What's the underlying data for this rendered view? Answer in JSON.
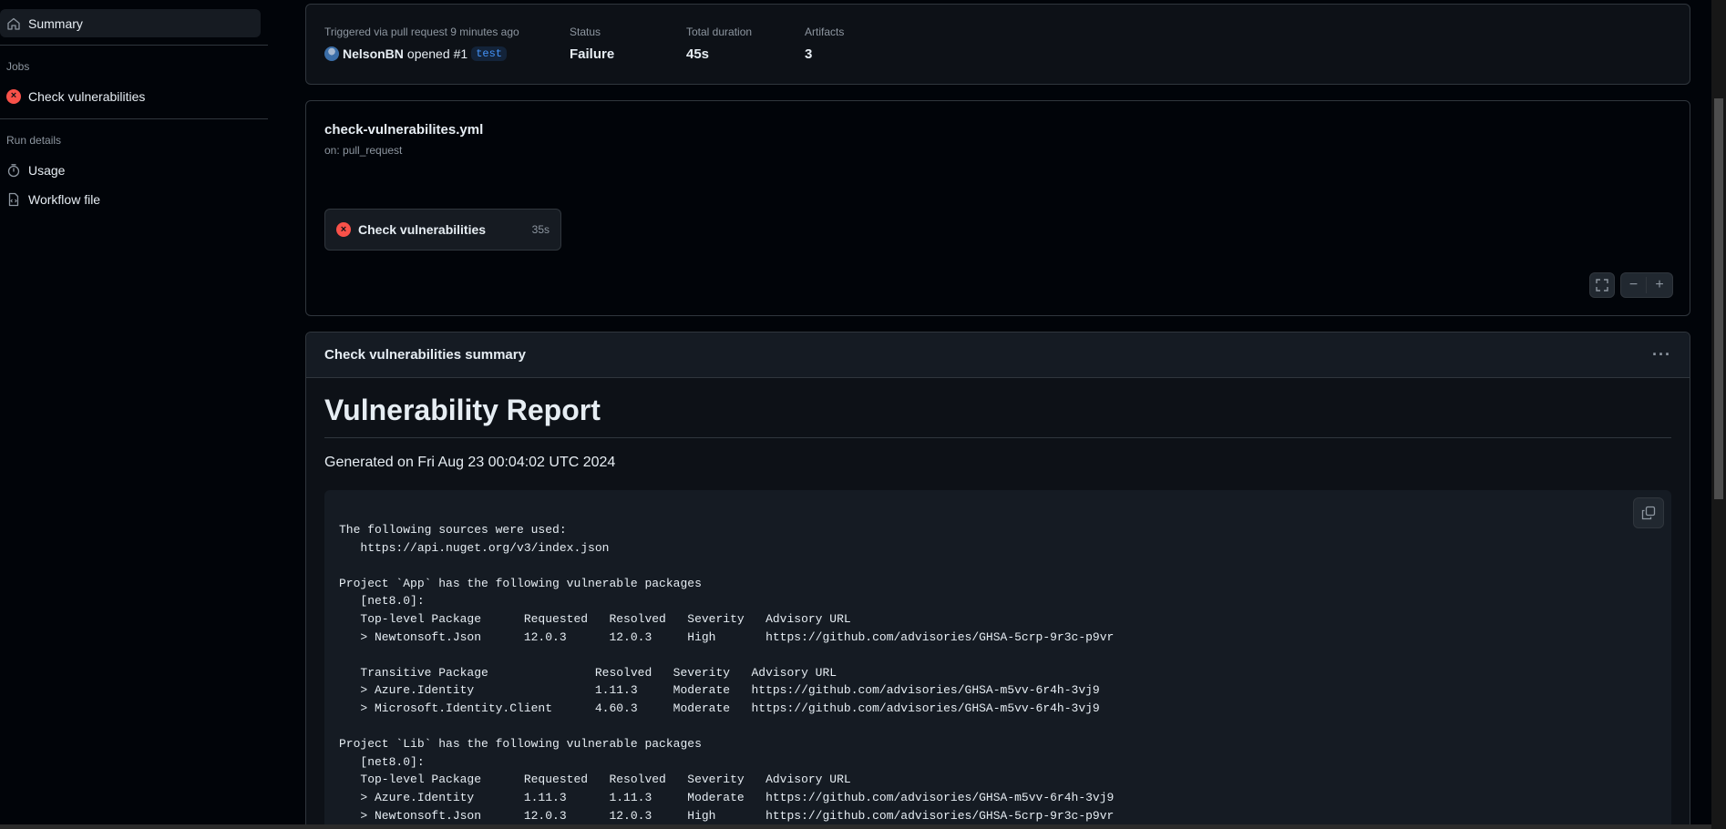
{
  "sidebar": {
    "summary": "Summary",
    "jobs_heading": "Jobs",
    "job_item": "Check vulnerabilities",
    "run_details_heading": "Run details",
    "usage": "Usage",
    "workflow_file": "Workflow file"
  },
  "run_info": {
    "trigger_label": "Triggered via pull request 9 minutes ago",
    "user": "NelsonBN",
    "action": "opened",
    "pr": "#1",
    "branch": "test",
    "status_label": "Status",
    "status_value": "Failure",
    "duration_label": "Total duration",
    "duration_value": "45s",
    "artifacts_label": "Artifacts",
    "artifacts_value": "3"
  },
  "workflow": {
    "filename": "check-vulnerabilites.yml",
    "trigger": "on: pull_request",
    "job_name": "Check vulnerabilities",
    "job_duration": "35s"
  },
  "summary": {
    "title": "Check vulnerabilities summary",
    "heading": "Vulnerability Report",
    "generated": "Generated on Fri Aug 23 00:04:02 UTC 2024",
    "code": "The following sources were used:\n   https://api.nuget.org/v3/index.json\n\nProject `App` has the following vulnerable packages\n   [net8.0]:\n   Top-level Package      Requested   Resolved   Severity   Advisory URL\n   > Newtonsoft.Json      12.0.3      12.0.3     High       https://github.com/advisories/GHSA-5crp-9r3c-p9vr\n\n   Transitive Package               Resolved   Severity   Advisory URL\n   > Azure.Identity                 1.11.3     Moderate   https://github.com/advisories/GHSA-m5vv-6r4h-3vj9\n   > Microsoft.Identity.Client      4.60.3     Moderate   https://github.com/advisories/GHSA-m5vv-6r4h-3vj9\n\nProject `Lib` has the following vulnerable packages\n   [net8.0]:\n   Top-level Package      Requested   Resolved   Severity   Advisory URL\n   > Azure.Identity       1.11.3      1.11.3     Moderate   https://github.com/advisories/GHSA-m5vv-6r4h-3vj9\n   > Newtonsoft.Json      12.0.3      12.0.3     High       https://github.com/advisories/GHSA-5crp-9r3c-p9vr"
  },
  "colors": {
    "background": "#010409",
    "card": "#0d1117",
    "border": "#30363d",
    "failure": "#f85149",
    "link": "#4493f8"
  }
}
